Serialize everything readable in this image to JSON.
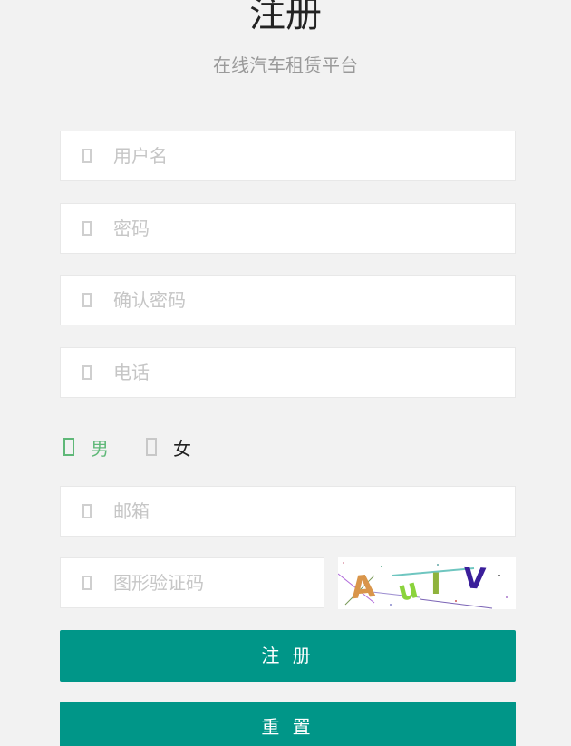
{
  "header": {
    "title": "注册",
    "subtitle": "在线汽车租赁平台"
  },
  "form": {
    "username": {
      "placeholder": "用户名",
      "value": ""
    },
    "password": {
      "placeholder": "密码",
      "value": ""
    },
    "confirm_password": {
      "placeholder": "确认密码",
      "value": ""
    },
    "phone": {
      "placeholder": "电话",
      "value": ""
    },
    "gender": {
      "options": [
        {
          "label": "男",
          "selected": true
        },
        {
          "label": "女",
          "selected": false
        }
      ]
    },
    "email": {
      "placeholder": "邮箱",
      "value": ""
    },
    "captcha": {
      "placeholder": "图形验证码",
      "value": "",
      "image_text": "AuIV"
    }
  },
  "buttons": {
    "register": "注 册",
    "reset": "重 置"
  },
  "colors": {
    "primary": "#009688",
    "selected": "#5fb878",
    "background": "#f2f2f2"
  }
}
